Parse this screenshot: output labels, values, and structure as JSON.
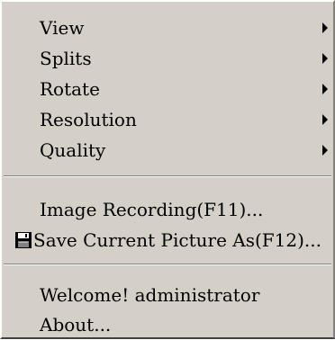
{
  "menu": {
    "submenu_items": [
      {
        "label": "View",
        "icon": "submenu-arrow-icon"
      },
      {
        "label": "Splits",
        "icon": "submenu-arrow-icon"
      },
      {
        "label": "Rotate",
        "icon": "submenu-arrow-icon"
      },
      {
        "label": "Resolution",
        "icon": "submenu-arrow-icon"
      },
      {
        "label": "Quality",
        "icon": "submenu-arrow-icon"
      }
    ],
    "recording": {
      "image_recording": "Image Recording(F11)...",
      "save_picture": "Save Current Picture As(F12)...",
      "save_picture_icon": "floppy-disk-icon"
    },
    "info": {
      "welcome": "Welcome! administrator",
      "about": "About..."
    }
  },
  "colors": {
    "menu_background": "#d4d0c8",
    "text": "#000000",
    "separator_shadow": "#808080",
    "separator_highlight": "#ffffff"
  }
}
